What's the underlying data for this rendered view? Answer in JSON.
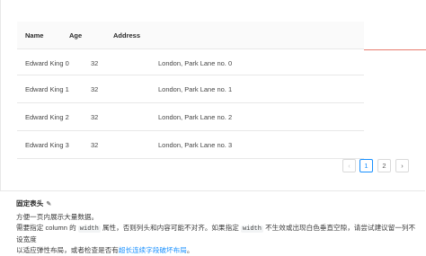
{
  "table": {
    "columns": [
      "Name",
      "Age",
      "Address"
    ],
    "rows": [
      {
        "name": "Edward King 0",
        "age": "32",
        "address": "London, Park Lane no. 0"
      },
      {
        "name": "Edward King 1",
        "age": "32",
        "address": "London, Park Lane no. 1"
      },
      {
        "name": "Edward King 2",
        "age": "32",
        "address": "London, Park Lane no. 2"
      },
      {
        "name": "Edward King 3",
        "age": "32",
        "address": "London, Park Lane no. 3"
      }
    ]
  },
  "pagination": {
    "prev": "‹",
    "pages": [
      "1",
      "2"
    ],
    "active_page": "1",
    "next": "›"
  },
  "description": {
    "title": "固定表头",
    "edit_icon": "✎",
    "line1": "方便一页内展示大量数据。",
    "line2_prefix": "需要指定 column 的",
    "code1": "width",
    "line2_mid": "属性，否则列头和内容可能不对齐。如果指定",
    "code2": "width",
    "line2_suffix": "不生效或出现白色垂直空隙，请尝试建议留一列不设宽度",
    "line3_prefix": "以适应弹性布局，或者检查是否有",
    "line3_link": "超长连续字段破坏布局",
    "line3_suffix": "。"
  },
  "colors": {
    "primary": "#1890ff",
    "scroll_indicator": "#e25b4b"
  }
}
